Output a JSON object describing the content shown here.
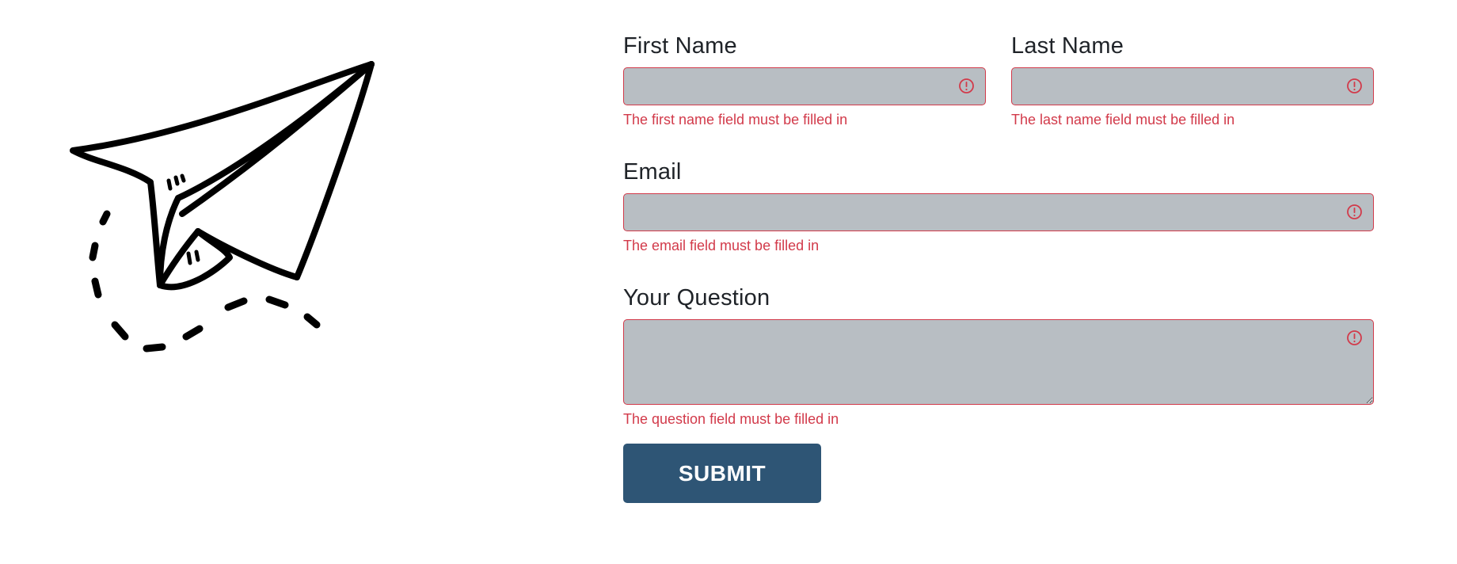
{
  "form": {
    "first_name": {
      "label": "First Name",
      "value": "",
      "error": "The first name field must be filled in",
      "icon": "error-circle-icon"
    },
    "last_name": {
      "label": "Last Name",
      "value": "",
      "error": "The last name field must be filled in",
      "icon": "error-circle-icon"
    },
    "email": {
      "label": "Email",
      "value": "",
      "error": "The email field must be filled in",
      "icon": "error-circle-icon"
    },
    "question": {
      "label": "Your Question",
      "value": "",
      "error": "The question field must be filled in",
      "icon": "error-circle-icon"
    },
    "submit_label": "SUBMIT"
  },
  "illustration": {
    "icon": "paper-plane-icon"
  },
  "colors": {
    "error": "#d23a4a",
    "input_background": "#b8bec3",
    "button_background": "#2e5575",
    "text": "#1f2328"
  }
}
